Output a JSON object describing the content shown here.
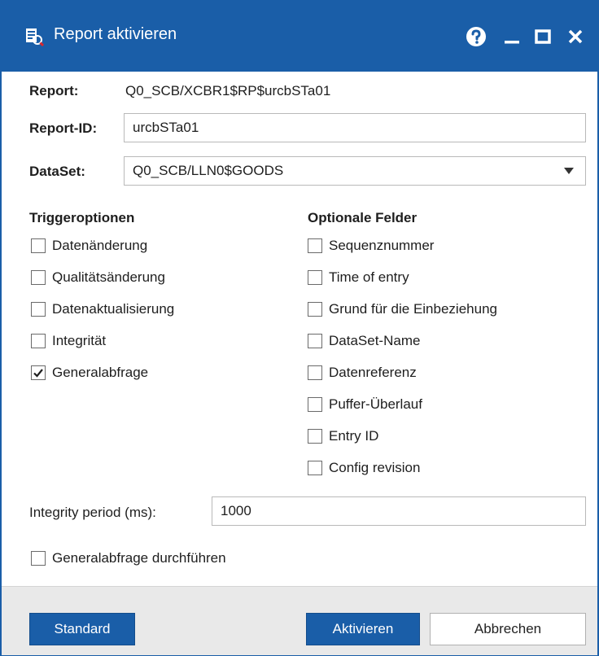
{
  "window": {
    "title": "Report aktivieren",
    "accent_color": "#1a5ea8",
    "controls": [
      "help-icon",
      "minimize-icon",
      "maximize-icon",
      "close-icon"
    ]
  },
  "form": {
    "report_label": "Report:",
    "report_value": "Q0_SCB/XCBR1$RP$urcbSTa01",
    "report_id_label": "Report-ID:",
    "report_id_value": "urcbSTa01",
    "dataset_label": "DataSet:",
    "dataset_value": "Q0_SCB/LLN0$GOODS"
  },
  "trigger": {
    "title": "Triggeroptionen",
    "options": [
      {
        "label": "Datenänderung",
        "checked": false
      },
      {
        "label": "Qualitätsänderung",
        "checked": false
      },
      {
        "label": "Datenaktualisierung",
        "checked": false
      },
      {
        "label": "Integrität",
        "checked": false
      },
      {
        "label": "Generalabfrage",
        "checked": true
      }
    ]
  },
  "optional": {
    "title": "Optionale Felder",
    "options": [
      {
        "label": "Sequenznummer",
        "checked": false
      },
      {
        "label": "Time of entry",
        "checked": false
      },
      {
        "label": "Grund für die Einbeziehung",
        "checked": false
      },
      {
        "label": "DataSet-Name",
        "checked": false
      },
      {
        "label": "Datenreferenz",
        "checked": false
      },
      {
        "label": "Puffer-Überlauf",
        "checked": false
      },
      {
        "label": "Entry ID",
        "checked": false
      },
      {
        "label": "Config revision",
        "checked": false
      }
    ]
  },
  "integrity": {
    "label": "Integrity period (ms):",
    "value": "1000"
  },
  "gi_execute": {
    "label": "Generalabfrage durchführen",
    "checked": false
  },
  "buttons": {
    "standard": "Standard",
    "activate": "Aktivieren",
    "cancel": "Abbrechen"
  }
}
